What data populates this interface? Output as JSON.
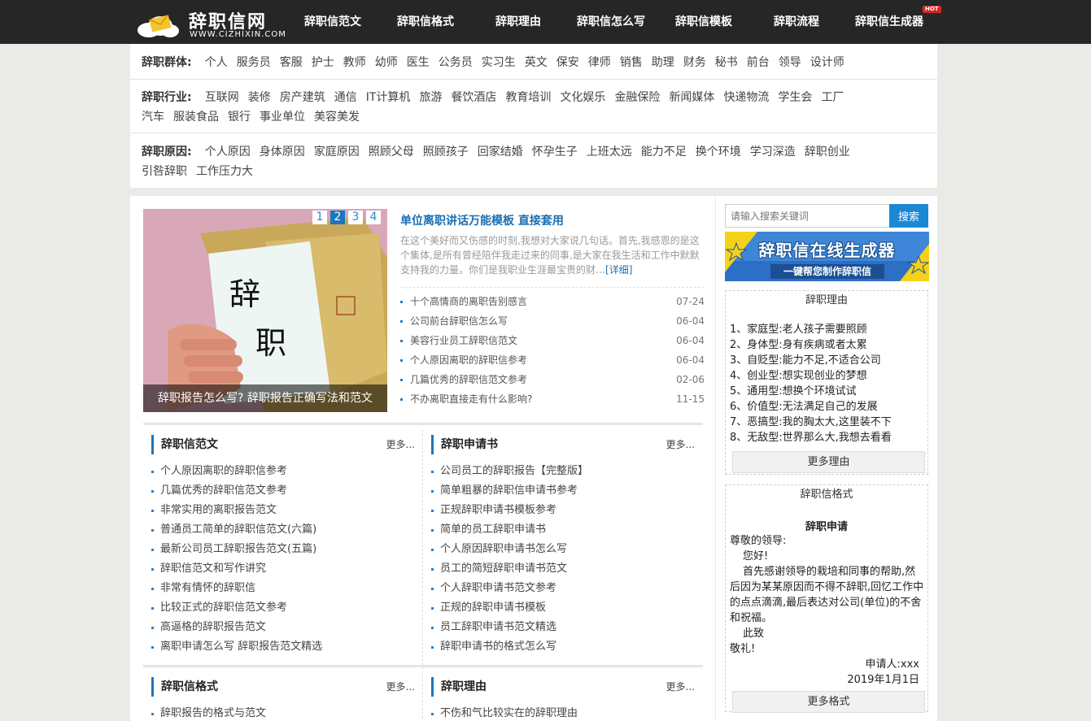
{
  "site": {
    "title": "辞职信网",
    "domain": "WWW.CIZHIXIN.COM"
  },
  "nav": {
    "items": [
      {
        "label": "辞职信范文"
      },
      {
        "label": "辞职信格式"
      },
      {
        "label": "辞职理由"
      },
      {
        "label": "辞职信怎么写"
      },
      {
        "label": "辞职信模板"
      },
      {
        "label": "辞职流程"
      },
      {
        "label": "辞职信生成器",
        "badge": "HOT"
      }
    ]
  },
  "filters": {
    "groups": {
      "label": "辞职群体:",
      "options": [
        "个人",
        "服务员",
        "客服",
        "护士",
        "教师",
        "幼师",
        "医生",
        "公务员",
        "实习生",
        "英文",
        "保安",
        "律师",
        "销售",
        "助理",
        "财务",
        "秘书",
        "前台",
        "领导",
        "设计师"
      ]
    },
    "industry": {
      "label": "辞职行业:",
      "options_row1": [
        "互联网",
        "装修",
        "房产建筑",
        "通信",
        "IT计算机",
        "旅游",
        "餐饮酒店",
        "教育培训",
        "文化娱乐",
        "金融保险",
        "新闻媒体",
        "快递物流",
        "学生会",
        "工厂"
      ],
      "options_row2": [
        "汽车",
        "服装食品",
        "银行",
        "事业单位",
        "美容美发"
      ]
    },
    "reasons": {
      "label": "辞职原因:",
      "options_row1": [
        "个人原因",
        "身体原因",
        "家庭原因",
        "照顾父母",
        "照顾孩子",
        "回家结婚",
        "怀孕生子",
        "上班太远",
        "能力不足",
        "换个环境",
        "学习深造",
        "辞职创业"
      ],
      "options_row2": [
        "引咎辞职",
        "工作压力大"
      ]
    }
  },
  "slide": {
    "caption": "辞职报告怎么写? 辞职报告正确写法和范文",
    "pages": [
      "1",
      "2",
      "3",
      "4"
    ],
    "active_page": "2",
    "card_text_top": "辞",
    "card_text_bottom": "职"
  },
  "headline": {
    "title": "单位离职讲话万能模板 直接套用",
    "summary": "在这个美好而又伤感的时刻,我想对大家说几句话。首先,我感恩的是这个集体,是所有曾经陪伴我走过来的同事,是大家在我生活和工作中默默支持我的力量。你们是我职业生涯最宝贵的财…",
    "more": "[详细]"
  },
  "latest": [
    {
      "title": "十个高情商的离职告别感言",
      "date": "07-24"
    },
    {
      "title": "公司前台辞职信怎么写",
      "date": "06-04"
    },
    {
      "title": "美容行业员工辞职信范文",
      "date": "06-04"
    },
    {
      "title": "个人原因离职的辞职信参考",
      "date": "06-04"
    },
    {
      "title": "几篇优秀的辞职信范文参考",
      "date": "02-06"
    },
    {
      "title": "不办离职直接走有什么影响?",
      "date": "11-15"
    }
  ],
  "boxes": {
    "sample_letters": {
      "title": "辞职信范文",
      "more": "更多...",
      "items": [
        "个人原因离职的辞职信参考",
        "几篇优秀的辞职信范文参考",
        "非常实用的离职报告范文",
        "普通员工简单的辞职信范文(六篇)",
        "最新公司员工辞职报告范文(五篇)",
        "辞职信范文和写作讲究",
        "非常有情怀的辞职信",
        "比较正式的辞职信范文参考",
        "高逼格的辞职报告范文",
        "离职申请怎么写 辞职报告范文精选"
      ]
    },
    "applications": {
      "title": "辞职申请书",
      "more": "更多...",
      "items": [
        "公司员工的辞职报告【完整版】",
        "简单粗暴的辞职信申请书参考",
        "正规辞职申请书模板参考",
        "简单的员工辞职申请书",
        "个人原因辞职申请书怎么写",
        "员工的简短辞职申请书范文",
        "个人辞职申请书范文参考",
        "正规的辞职申请书模板",
        "员工辞职申请书范文精选",
        "辞职申请书的格式怎么写"
      ]
    },
    "letter_format": {
      "title": "辞职信格式",
      "more": "更多...",
      "items": [
        "辞职报告的格式与范文"
      ]
    },
    "resign_reasons": {
      "title": "辞职理由",
      "more": "更多...",
      "items": [
        "不伤和气比较实在的辞职理由"
      ]
    }
  },
  "sidebar": {
    "search": {
      "placeholder": "请输入搜索关键词",
      "button": "搜索"
    },
    "banner": {
      "line1": "辞职信在线生成器",
      "line2": "一键帮您制作辞职信"
    },
    "reasons": {
      "title": "辞职理由",
      "items": [
        "1、家庭型:老人孩子需要照顾",
        "2、身体型:身有疾病或者太累",
        "3、自贬型:能力不足,不适合公司",
        "4、创业型:想实现创业的梦想",
        "5、通用型:想换个环境试试",
        "6、价值型:无法满足自己的发展",
        "7、恶搞型:我的胸太大,这里装不下",
        "8、无敌型:世界那么大,我想去看看"
      ],
      "more": "更多理由"
    },
    "format": {
      "title": "辞职信格式",
      "letter_title": "辞职申请",
      "salutation": "尊敬的领导:",
      "greeting": "您好!",
      "body": "首先感谢领导的栽培和同事的帮助,然后因为某某原因而不得不辞职,回忆工作中的点点滴滴,最后表达对公司(单位)的不舍和祝福。",
      "closing1": "此致",
      "closing2": "敬礼!",
      "signer": "申请人:xxx",
      "date": "2019年1月1日",
      "more": "更多格式"
    }
  },
  "colors": {
    "topbar": "#262626",
    "accent": "#1b76be",
    "link_blue": "#1c6fb3",
    "search_button": "#1b88d6",
    "hot": "#dd2222"
  }
}
